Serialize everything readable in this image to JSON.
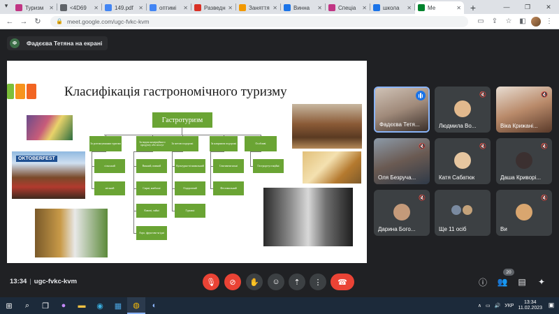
{
  "colors": {
    "meet_bg": "#202124",
    "tile_bg": "#3c4043",
    "end_call_red": "#ea4335",
    "slide_green": "#6aa434",
    "deco_green": "#7cbf3a",
    "deco_orange1": "#f7941d",
    "deco_orange2": "#f26522"
  },
  "browser": {
    "tabs": [
      {
        "label": "Туризм",
        "icon": "instagram-icon",
        "color": "#c13584"
      },
      {
        "label": "<4D69",
        "icon": "web-icon",
        "color": "#5f6368"
      },
      {
        "label": "149.pdf",
        "icon": "pdf-icon",
        "color": "#4285f4"
      },
      {
        "label": "оптимі",
        "icon": "google-icon",
        "color": "#4285f4"
      },
      {
        "label": "Разведн",
        "icon": "hh-icon",
        "color": "#d93025"
      },
      {
        "label": "Заняття",
        "icon": "classroom-icon",
        "color": "#f29900"
      },
      {
        "label": "Винна",
        "icon": "chrome-icon",
        "color": "#1a73e8"
      },
      {
        "label": "Спеціа",
        "icon": "instagram-icon",
        "color": "#c13584"
      },
      {
        "label": "школа",
        "icon": "chrome-icon",
        "color": "#1a73e8"
      },
      {
        "label": "Ме",
        "icon": "meet-icon",
        "color": "#00832d"
      }
    ],
    "url": "meet.google.com/ugc-fvkc-kvm"
  },
  "meet": {
    "presenter_banner": "Фадєєва Тетяна на екрані",
    "presenter_initial": "Ф",
    "meeting_time": "13:34",
    "meeting_code": "ugc-fvkc-kvm",
    "participant_count": "20",
    "participants": [
      {
        "name": "Фадєєва Тетя...",
        "kind": "video",
        "speaking": true
      },
      {
        "name": "Людмила Во...",
        "kind": "avatar",
        "muted": true
      },
      {
        "name": "Віка Крижані...",
        "kind": "video",
        "muted": true
      },
      {
        "name": "Оля Безруча...",
        "kind": "video",
        "muted": true
      },
      {
        "name": "Катя Сабатюк",
        "kind": "avatar",
        "muted": true
      },
      {
        "name": "Даша Криворі...",
        "kind": "avatar",
        "muted": true
      },
      {
        "name": "Дарина Бого...",
        "kind": "avatar",
        "muted": true
      },
      {
        "name": "Ще 11 осіб",
        "kind": "group",
        "muted": false
      },
      {
        "name": "Ви",
        "kind": "avatar",
        "muted": true
      }
    ]
  },
  "slide": {
    "title": "Класифікація гастрономічного туризму",
    "root": "Гастротуризм",
    "categories": [
      "За розташуванням туризма",
      "За видом комерційного продукту або послуг",
      "За метою подорожі",
      "За напрямом подорожі",
      "Особливі"
    ],
    "col1": [
      "сільський",
      "міський"
    ],
    "col2": [
      "Винний, пивний",
      "Сирні, ковбасні",
      "Кавові, чайні",
      "Агро, фруктово-ягідні"
    ],
    "col3": [
      "Культурно-пізнавальний",
      "Оздоровчий",
      "Гурмані"
    ],
    "col4": [
      "Сентиментальні",
      "Фестивальний"
    ],
    "col5": [
      "Гастродегустаційні"
    ],
    "photo_sign": "OKTOBERFEST"
  },
  "taskbar": {
    "lang": "УКР",
    "time": "13:34",
    "date": "11.02.2023"
  }
}
